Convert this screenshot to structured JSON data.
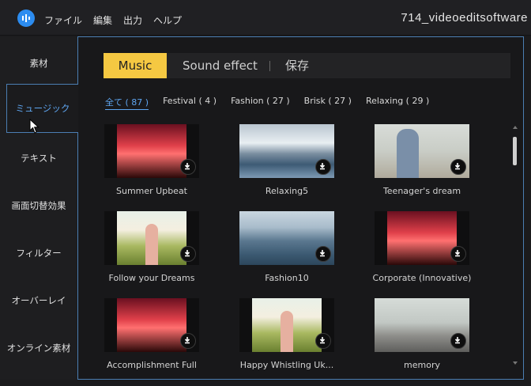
{
  "window": {
    "title": "714_videoeditsoftware"
  },
  "menu": [
    "ファイル",
    "編集",
    "出力",
    "ヘルプ"
  ],
  "sidebar": {
    "items": [
      {
        "label": "素材"
      },
      {
        "label": "ミュージック",
        "active": true
      },
      {
        "label": "テキスト"
      },
      {
        "label": "画面切替効果"
      },
      {
        "label": "フィルター"
      },
      {
        "label": "オーバーレイ"
      },
      {
        "label": "オンライン素材"
      }
    ]
  },
  "tabs": [
    {
      "label": "Music",
      "active": true
    },
    {
      "label": "Sound effect"
    },
    {
      "label": "保存"
    }
  ],
  "filters": [
    {
      "label": "全て ( 87 )",
      "active": true
    },
    {
      "label": "Festival ( 4 )"
    },
    {
      "label": "Fashion ( 27 )"
    },
    {
      "label": "Brisk ( 27 )"
    },
    {
      "label": "Relaxing ( 29 )"
    }
  ],
  "cards": [
    {
      "title": "Summer Upbeat",
      "thumb": "concert"
    },
    {
      "title": "Relaxing5",
      "thumb": "lake-mountains"
    },
    {
      "title": "Teenager's dream",
      "thumb": "girl-beach"
    },
    {
      "title": "Follow your Dreams",
      "thumb": "girl-field"
    },
    {
      "title": "Fashion10",
      "thumb": "mountains"
    },
    {
      "title": "Corporate (Innovative)",
      "thumb": "concert"
    },
    {
      "title": "Accomplishment Full",
      "thumb": "concert"
    },
    {
      "title": "Happy Whistling Uk...",
      "thumb": "girl-field"
    },
    {
      "title": "memory",
      "thumb": "sneakers"
    }
  ],
  "colors": {
    "accent": "#f5c842",
    "link": "#5ea5f0",
    "border": "#4b7eb3"
  }
}
